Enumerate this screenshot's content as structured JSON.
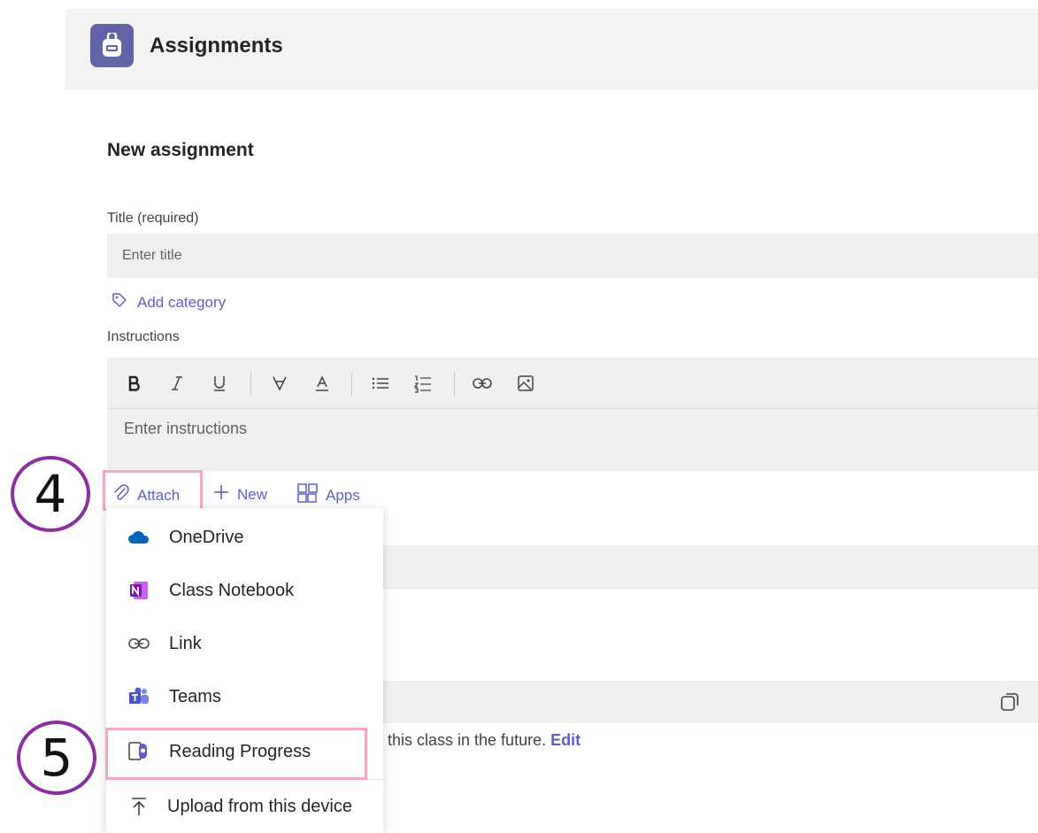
{
  "header": {
    "app_title": "Assignments",
    "app_icon": "backpack-icon",
    "accent": "#6264a7"
  },
  "form": {
    "page_title": "New assignment",
    "title_label": "Title (required)",
    "title_placeholder": "Enter title",
    "add_category": "Add category",
    "instructions_label": "Instructions",
    "instructions_placeholder": "Enter instructions",
    "toolbar": [
      "bold-icon",
      "italic-icon",
      "underline-icon",
      "highlight-icon",
      "font-color-icon",
      "bulleted-list-icon",
      "numbered-list-icon",
      "link-icon",
      "image-icon"
    ],
    "background_text": "this class in the future.",
    "background_edit": "Edit"
  },
  "actions": {
    "attach": "Attach",
    "new": "New",
    "apps": "Apps"
  },
  "attach_menu": {
    "items": [
      {
        "label": "OneDrive",
        "icon": "onedrive-icon"
      },
      {
        "label": "Class Notebook",
        "icon": "onenote-icon"
      },
      {
        "label": "Link",
        "icon": "link-icon"
      },
      {
        "label": "Teams",
        "icon": "teams-icon"
      },
      {
        "label": "Reading Progress",
        "icon": "reading-progress-icon"
      },
      {
        "label": "Upload from this device",
        "icon": "upload-icon"
      }
    ]
  },
  "annotations": {
    "step_4": "4",
    "step_5": "5",
    "highlight_color": "#f4a7c3",
    "circle_color": "#8a2f9e"
  }
}
